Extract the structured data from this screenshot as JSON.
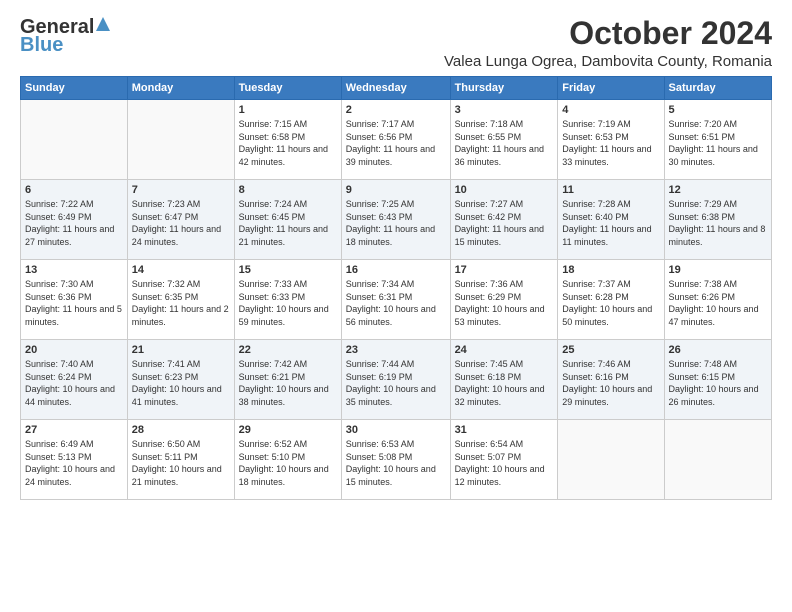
{
  "header": {
    "logo_general": "General",
    "logo_blue": "Blue",
    "month_title": "October 2024",
    "location": "Valea Lunga Ogrea, Dambovita County, Romania"
  },
  "weekdays": [
    "Sunday",
    "Monday",
    "Tuesday",
    "Wednesday",
    "Thursday",
    "Friday",
    "Saturday"
  ],
  "weeks": [
    [
      {
        "day": "",
        "info": ""
      },
      {
        "day": "",
        "info": ""
      },
      {
        "day": "1",
        "info": "Sunrise: 7:15 AM\nSunset: 6:58 PM\nDaylight: 11 hours and 42 minutes."
      },
      {
        "day": "2",
        "info": "Sunrise: 7:17 AM\nSunset: 6:56 PM\nDaylight: 11 hours and 39 minutes."
      },
      {
        "day": "3",
        "info": "Sunrise: 7:18 AM\nSunset: 6:55 PM\nDaylight: 11 hours and 36 minutes."
      },
      {
        "day": "4",
        "info": "Sunrise: 7:19 AM\nSunset: 6:53 PM\nDaylight: 11 hours and 33 minutes."
      },
      {
        "day": "5",
        "info": "Sunrise: 7:20 AM\nSunset: 6:51 PM\nDaylight: 11 hours and 30 minutes."
      }
    ],
    [
      {
        "day": "6",
        "info": "Sunrise: 7:22 AM\nSunset: 6:49 PM\nDaylight: 11 hours and 27 minutes."
      },
      {
        "day": "7",
        "info": "Sunrise: 7:23 AM\nSunset: 6:47 PM\nDaylight: 11 hours and 24 minutes."
      },
      {
        "day": "8",
        "info": "Sunrise: 7:24 AM\nSunset: 6:45 PM\nDaylight: 11 hours and 21 minutes."
      },
      {
        "day": "9",
        "info": "Sunrise: 7:25 AM\nSunset: 6:43 PM\nDaylight: 11 hours and 18 minutes."
      },
      {
        "day": "10",
        "info": "Sunrise: 7:27 AM\nSunset: 6:42 PM\nDaylight: 11 hours and 15 minutes."
      },
      {
        "day": "11",
        "info": "Sunrise: 7:28 AM\nSunset: 6:40 PM\nDaylight: 11 hours and 11 minutes."
      },
      {
        "day": "12",
        "info": "Sunrise: 7:29 AM\nSunset: 6:38 PM\nDaylight: 11 hours and 8 minutes."
      }
    ],
    [
      {
        "day": "13",
        "info": "Sunrise: 7:30 AM\nSunset: 6:36 PM\nDaylight: 11 hours and 5 minutes."
      },
      {
        "day": "14",
        "info": "Sunrise: 7:32 AM\nSunset: 6:35 PM\nDaylight: 11 hours and 2 minutes."
      },
      {
        "day": "15",
        "info": "Sunrise: 7:33 AM\nSunset: 6:33 PM\nDaylight: 10 hours and 59 minutes."
      },
      {
        "day": "16",
        "info": "Sunrise: 7:34 AM\nSunset: 6:31 PM\nDaylight: 10 hours and 56 minutes."
      },
      {
        "day": "17",
        "info": "Sunrise: 7:36 AM\nSunset: 6:29 PM\nDaylight: 10 hours and 53 minutes."
      },
      {
        "day": "18",
        "info": "Sunrise: 7:37 AM\nSunset: 6:28 PM\nDaylight: 10 hours and 50 minutes."
      },
      {
        "day": "19",
        "info": "Sunrise: 7:38 AM\nSunset: 6:26 PM\nDaylight: 10 hours and 47 minutes."
      }
    ],
    [
      {
        "day": "20",
        "info": "Sunrise: 7:40 AM\nSunset: 6:24 PM\nDaylight: 10 hours and 44 minutes."
      },
      {
        "day": "21",
        "info": "Sunrise: 7:41 AM\nSunset: 6:23 PM\nDaylight: 10 hours and 41 minutes."
      },
      {
        "day": "22",
        "info": "Sunrise: 7:42 AM\nSunset: 6:21 PM\nDaylight: 10 hours and 38 minutes."
      },
      {
        "day": "23",
        "info": "Sunrise: 7:44 AM\nSunset: 6:19 PM\nDaylight: 10 hours and 35 minutes."
      },
      {
        "day": "24",
        "info": "Sunrise: 7:45 AM\nSunset: 6:18 PM\nDaylight: 10 hours and 32 minutes."
      },
      {
        "day": "25",
        "info": "Sunrise: 7:46 AM\nSunset: 6:16 PM\nDaylight: 10 hours and 29 minutes."
      },
      {
        "day": "26",
        "info": "Sunrise: 7:48 AM\nSunset: 6:15 PM\nDaylight: 10 hours and 26 minutes."
      }
    ],
    [
      {
        "day": "27",
        "info": "Sunrise: 6:49 AM\nSunset: 5:13 PM\nDaylight: 10 hours and 24 minutes."
      },
      {
        "day": "28",
        "info": "Sunrise: 6:50 AM\nSunset: 5:11 PM\nDaylight: 10 hours and 21 minutes."
      },
      {
        "day": "29",
        "info": "Sunrise: 6:52 AM\nSunset: 5:10 PM\nDaylight: 10 hours and 18 minutes."
      },
      {
        "day": "30",
        "info": "Sunrise: 6:53 AM\nSunset: 5:08 PM\nDaylight: 10 hours and 15 minutes."
      },
      {
        "day": "31",
        "info": "Sunrise: 6:54 AM\nSunset: 5:07 PM\nDaylight: 10 hours and 12 minutes."
      },
      {
        "day": "",
        "info": ""
      },
      {
        "day": "",
        "info": ""
      }
    ]
  ]
}
